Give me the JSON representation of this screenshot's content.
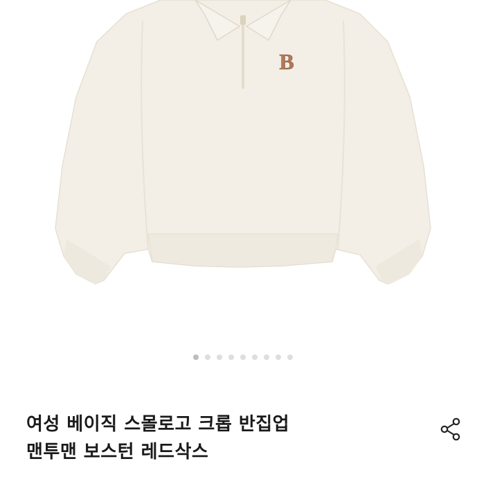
{
  "product": {
    "title_line1": "여성 베이직 스몰로고 크롭 반집업",
    "title_line2": "맨투맨 보스턴 레드삭스",
    "logo_letter": "B"
  },
  "gallery": {
    "image_count": 9,
    "active_index": 0
  },
  "icons": {
    "share": "share-icon"
  },
  "colors": {
    "garment": "#f3efe6",
    "logo": "#b07a5a",
    "dot_inactive": "#dedede",
    "dot_active": "#bdbdbd",
    "title_text": "#1a1a1a"
  }
}
